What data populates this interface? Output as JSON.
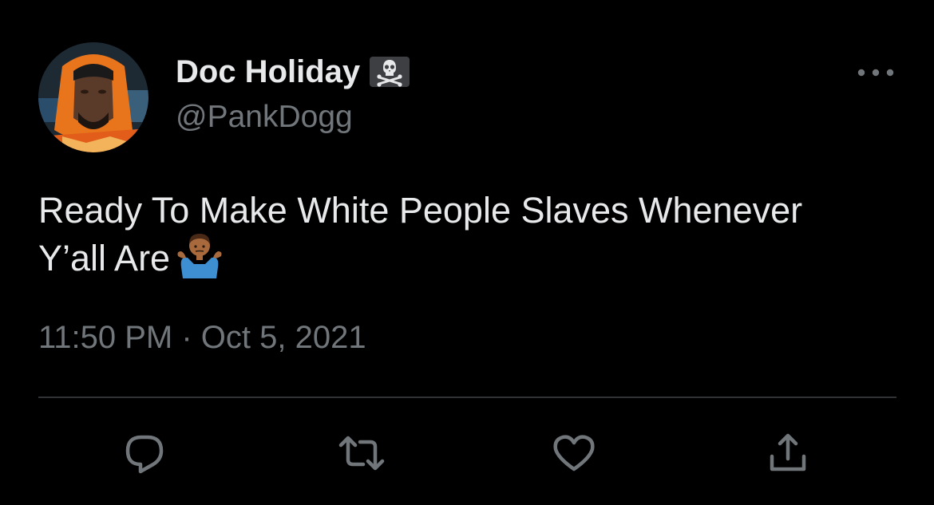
{
  "author": {
    "display_name": "Doc Holiday",
    "name_emoji": "skull-and-crossbones",
    "handle": "@PankDogg",
    "avatar": "avatar-photo"
  },
  "tweet": {
    "text_line1": "Ready To Make White People Slaves Whenever",
    "text_line2": "Y’all Are",
    "emoji": "person-shrugging",
    "timestamp": "11:50 PM · Oct 5, 2021"
  },
  "actions": {
    "reply": "reply-icon",
    "retweet": "retweet-icon",
    "like": "like-icon",
    "share": "share-icon"
  },
  "colors": {
    "background": "#000000",
    "primary_text": "#e7e9ea",
    "secondary_text": "#71767b",
    "divider": "#2f3336"
  }
}
